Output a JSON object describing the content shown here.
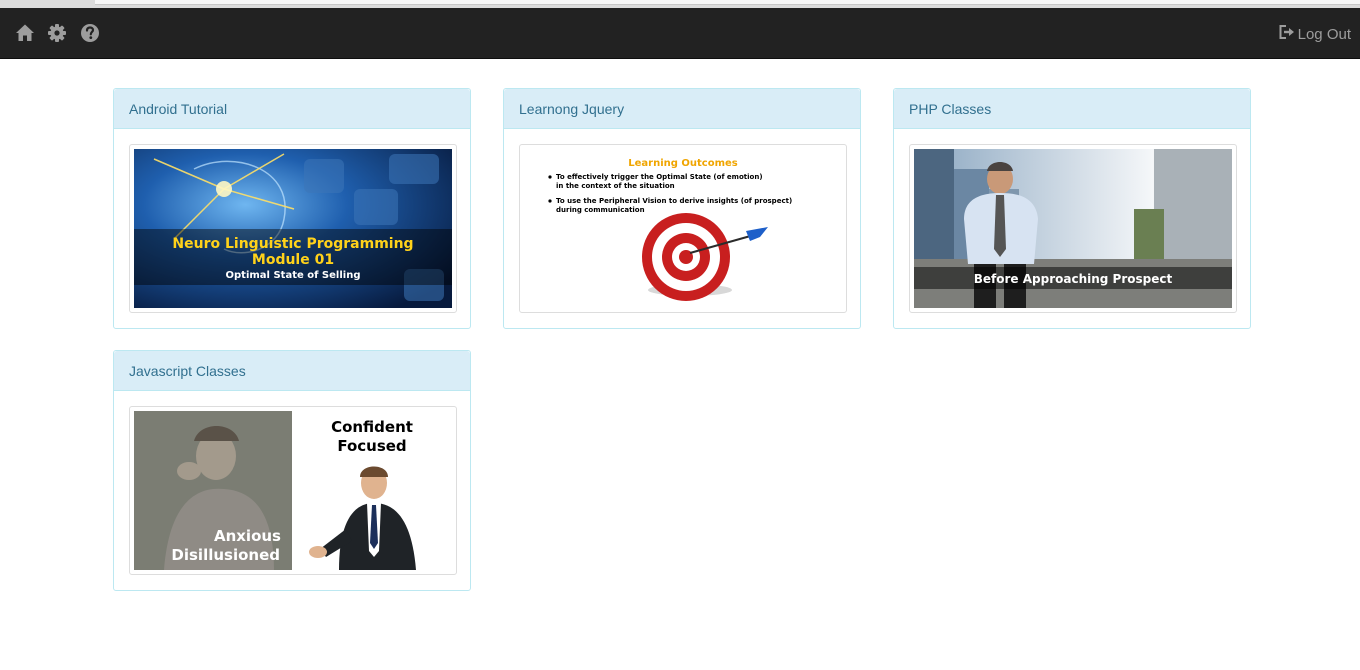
{
  "navbar": {
    "home_icon": "home-icon",
    "settings_icon": "gear-icon",
    "help_icon": "question-circle-icon",
    "logout_icon": "logout-icon",
    "logout_label": "Log Out"
  },
  "courses": [
    {
      "title": "Android Tutorial",
      "thumb_lines": [
        "Neuro Linguistic Programming",
        "Module 01",
        "Optimal State of Selling"
      ]
    },
    {
      "title": "Learnong Jquery",
      "thumb_heading": "Learning Outcomes",
      "thumb_bullets": [
        [
          "To effectively trigger the Optimal State (of emotion)",
          "in the context of the situation"
        ],
        [
          "To use the Peripheral Vision to derive insights (of prospect)",
          "during communication"
        ]
      ]
    },
    {
      "title": "PHP Classes",
      "thumb_caption": "Before Approaching Prospect"
    },
    {
      "title": "Javascript Classes",
      "thumb_left": [
        "Anxious",
        "Disillusioned"
      ],
      "thumb_right": [
        "Confident",
        "Focused"
      ]
    }
  ],
  "colors": {
    "navbar_bg": "#222222",
    "panel_heading_bg": "#d9edf7",
    "panel_border": "#bce8f1",
    "panel_heading_text": "#31708f"
  }
}
